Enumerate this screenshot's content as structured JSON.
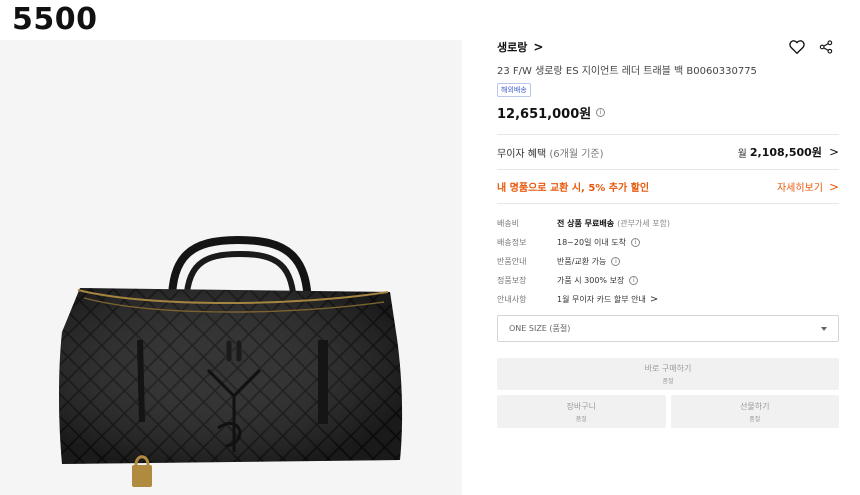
{
  "overlay_number": "5500",
  "product_image": {
    "alt": "quilted black leather travel bag"
  },
  "brand": {
    "name": "생로랑",
    "chevron": ">"
  },
  "actions": {
    "wishlist_icon": "heart-icon",
    "share_icon": "share-icon"
  },
  "product": {
    "title": "23 F/W 생로랑 ES 지이언트 레더 트래블 백 B0060330775",
    "badge": "해외배송",
    "price": "12,651,000원"
  },
  "installment": {
    "label": "무이자 혜택",
    "sub": "(6개월 기준)",
    "prefix": "월",
    "amount": "2,108,500원",
    "chevron": ">"
  },
  "promo": {
    "text": "내 명품으로 교환 시, 5% 추가 할인",
    "link": "자세히보기",
    "chevron": ">"
  },
  "info": {
    "shipping_fee": {
      "key": "배송비",
      "value": "전 상품 무료배송",
      "note": "(관부가세 포함)"
    },
    "delivery": {
      "key": "배송정보",
      "value": "18~20일 이내 도착"
    },
    "returns": {
      "key": "반품안내",
      "value": "반품/교환 가능"
    },
    "warranty": {
      "key": "정품보장",
      "value": "가품 시 300% 보장"
    },
    "card": {
      "key": "안내사항",
      "value": "1월 무이자 카드 할부 안내",
      "chevron": ">"
    }
  },
  "option_select": {
    "value": "ONE SIZE (품절)"
  },
  "buttons": {
    "buy_now": {
      "label": "바로 구매하기",
      "sub": "품절"
    },
    "cart": {
      "label": "장바구니",
      "sub": "품절"
    },
    "gift": {
      "label": "선물하기",
      "sub": "품절"
    }
  },
  "colors": {
    "accent": "#e8590c",
    "badge": "#3b5ccc",
    "disabled_bg": "#f1f1f1"
  }
}
